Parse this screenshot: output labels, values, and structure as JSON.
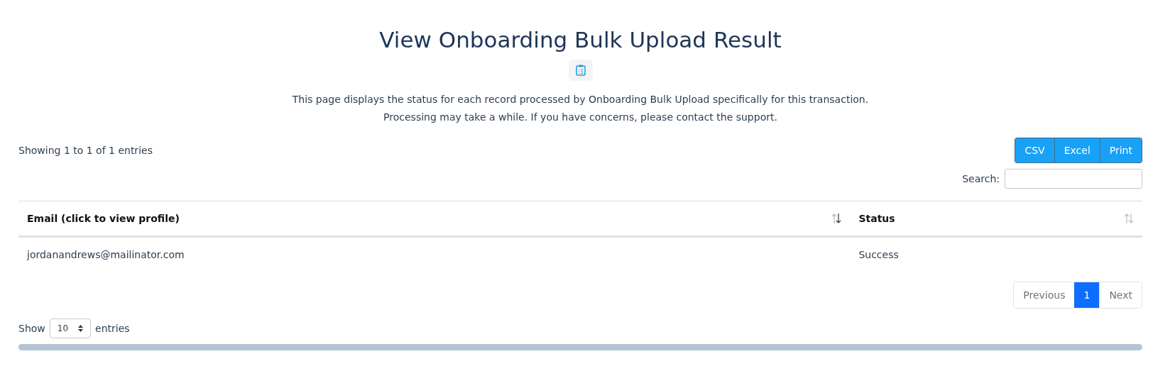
{
  "title": "View Onboarding Bulk Upload Result",
  "description": [
    "This page displays the status for each record processed by Onboarding Bulk Upload specifically for this transaction.",
    "Processing may take a while. If you have concerns, please contact the support."
  ],
  "info": "Showing 1 to 1 of 1 entries",
  "export_buttons": [
    "CSV",
    "Excel",
    "Print"
  ],
  "search": {
    "label": "Search:"
  },
  "table": {
    "columns": [
      {
        "label": "Email (click to view profile)",
        "sorted": true
      },
      {
        "label": "Status",
        "sorted": false
      }
    ],
    "rows": [
      [
        "jordanandrews@mailinator.com",
        "Success"
      ]
    ]
  },
  "pagination": [
    {
      "label": "Previous",
      "kind": "nav",
      "selected": false
    },
    {
      "label": "1",
      "kind": "page",
      "selected": true
    },
    {
      "label": "Next",
      "kind": "nav",
      "selected": false
    }
  ],
  "length": {
    "before": "Show",
    "value": "10",
    "after": "entries"
  }
}
